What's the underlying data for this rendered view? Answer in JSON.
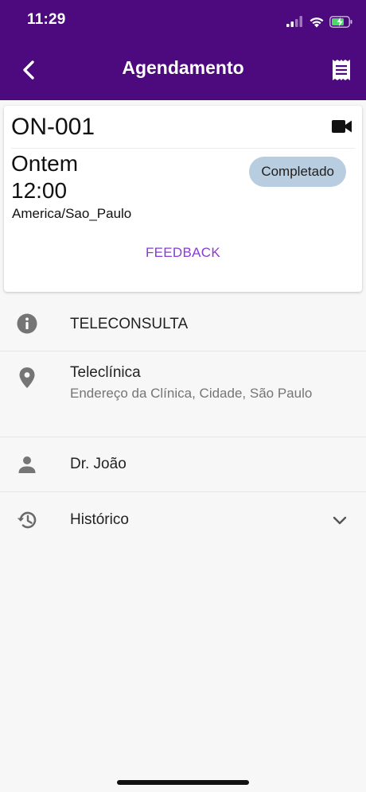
{
  "status_bar": {
    "time": "11:29",
    "icons": [
      "signal-icon",
      "wifi-icon",
      "battery-charging-icon"
    ]
  },
  "app_bar": {
    "title": "Agendamento",
    "back_icon": "chevron-left-icon",
    "action_icon": "receipt-icon",
    "background_color": "#4c0a7e"
  },
  "appointment_card": {
    "code": "ON-001",
    "type_icon": "videocam-icon",
    "day": "Ontem",
    "time": "12:00",
    "timezone": "America/Sao_Paulo",
    "status": "Completado",
    "status_color": "#b8cde0",
    "feedback_label": "FEEDBACK",
    "feedback_color": "#8a3ad6"
  },
  "details": {
    "type": {
      "icon": "info-icon",
      "label": "TELECONSULTA"
    },
    "location": {
      "icon": "location-pin-icon",
      "name": "Teleclínica",
      "address": "Endereço da Clínica, Cidade, São Paulo"
    },
    "doctor": {
      "icon": "person-icon",
      "name": "Dr. João"
    },
    "history": {
      "icon": "history-icon",
      "label": "Histórico",
      "expand_icon": "chevron-down-icon"
    }
  }
}
